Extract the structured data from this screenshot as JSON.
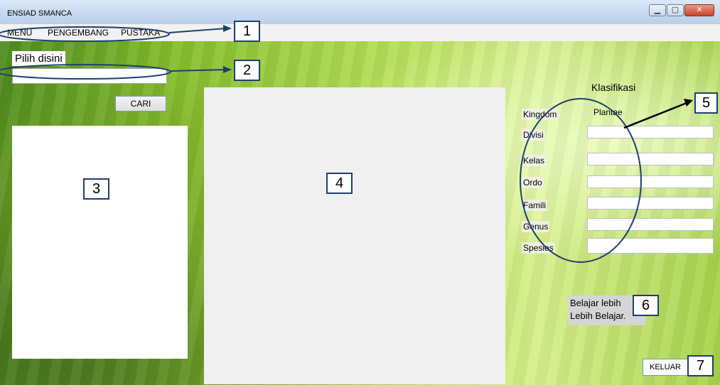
{
  "window": {
    "title": "ENSIAD SMANCA"
  },
  "menu": [
    "MENU",
    "PENGEMBANG",
    "PUSTAKA"
  ],
  "search": {
    "label": "Pilih disini",
    "value": "",
    "button": "CARI"
  },
  "klasifikasi": {
    "title": "Klasifikasi",
    "rows": [
      {
        "label": "Kingdom",
        "value": "Plantae"
      },
      {
        "label": "Divisi",
        "value": ""
      },
      {
        "label": "Kelas",
        "value": ""
      },
      {
        "label": "Ordo",
        "value": ""
      },
      {
        "label": "Famili",
        "value": ""
      },
      {
        "label": "Genus",
        "value": ""
      },
      {
        "label": "Spesies",
        "value": ""
      }
    ]
  },
  "motto": {
    "line1": "Belajar lebih",
    "line2": "Lebih Belajar."
  },
  "exit_button": "KELUAR",
  "annotations": [
    "1",
    "2",
    "3",
    "4",
    "5",
    "6",
    "7"
  ],
  "colors": {
    "annotation_stroke": "#1f3f6e",
    "background_green": "#86be2c"
  }
}
